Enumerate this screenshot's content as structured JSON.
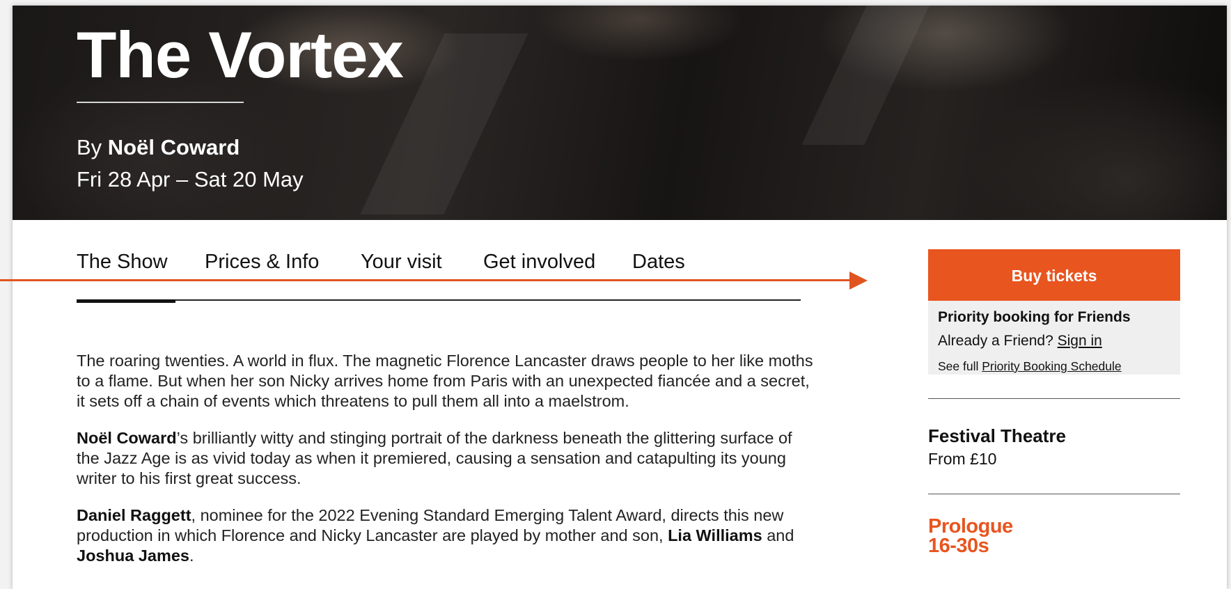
{
  "hero": {
    "title": "The Vortex",
    "author_prefix": "By ",
    "author_name": "Noël Coward",
    "dates": "Fri 28 Apr – Sat 20 May"
  },
  "tabs": [
    {
      "label": "The Show",
      "active": true
    },
    {
      "label": "Prices & Info",
      "active": false
    },
    {
      "label": "Your visit",
      "active": false
    },
    {
      "label": "Get involved",
      "active": false
    },
    {
      "label": "Dates",
      "active": false
    }
  ],
  "description": {
    "p1": "The roaring twenties. A world in flux. The magnetic Florence Lancaster draws people to her like moths to a flame. But when her son Nicky arrives home from Paris with an unexpected fiancée and a secret, it sets off a chain of events which threatens to pull them all into a maelstrom.",
    "p2_bold": "Noël Coward",
    "p2_rest": "’s brilliantly witty and stinging portrait of the darkness beneath the glittering surface of the Jazz Age is as vivid today as when it premiered, causing a sensation and catapulting its young writer to his first great success.",
    "p3_bold": "Daniel Raggett",
    "p3_rest": ", nominee for the 2022 Evening Standard Emerging Talent Award, directs this new production in which Florence and Nicky Lancaster are played by mother and son, ",
    "p3_actor1": "Lia Williams",
    "p3_and": " and ",
    "p3_actor2": "Joshua James",
    "p3_end": "."
  },
  "sidebar": {
    "buy_label": "Buy tickets",
    "priority_title": "Priority booking for Friends",
    "already_friend": "Already a Friend? ",
    "sign_in": "Sign in",
    "see_full": "See full ",
    "schedule_link": "Priority Booking Schedule",
    "venue": "Festival Theatre",
    "price": "From £10",
    "prologue_line1": "Prologue",
    "prologue_line2": "16-30s"
  },
  "colors": {
    "accent": "#e8551f",
    "annotation_arrow": "#e05420"
  }
}
